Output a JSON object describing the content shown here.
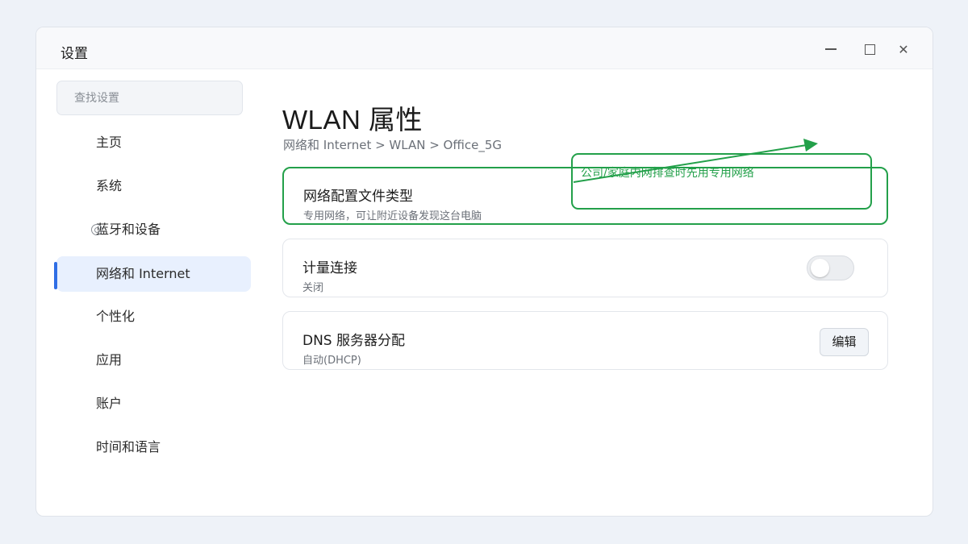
{
  "window": {
    "title": "设置"
  },
  "sidebar": {
    "search_placeholder": "查找设置",
    "items": [
      {
        "label": "主页"
      },
      {
        "label": "系统"
      },
      {
        "label": "蓝牙和设备",
        "icon": "bluetooth-device-icon"
      },
      {
        "label": "网络和 Internet",
        "active": true
      },
      {
        "label": "个性化"
      },
      {
        "label": "应用"
      },
      {
        "label": "账户"
      },
      {
        "label": "时间和语言"
      }
    ]
  },
  "main": {
    "title": "WLAN 属性",
    "breadcrumb": "网络和 Internet > WLAN > Office_5G",
    "cards": [
      {
        "title": "网络配置文件类型",
        "subtitle": "专用网络，可让附近设备发现这台电脑",
        "highlighted": true
      },
      {
        "title": "计量连接",
        "subtitle": "关闭",
        "toggle": false
      },
      {
        "title": "DNS 服务器分配",
        "subtitle": "自动(DHCP)",
        "button": "编辑"
      }
    ]
  },
  "annotation": {
    "text": "公司/家庭内网排查时先用专用网络",
    "color": "#23a04a"
  },
  "colors": {
    "accent": "#2f6ee5",
    "active_bg": "#e8f0fe",
    "annotation": "#23a04a"
  }
}
